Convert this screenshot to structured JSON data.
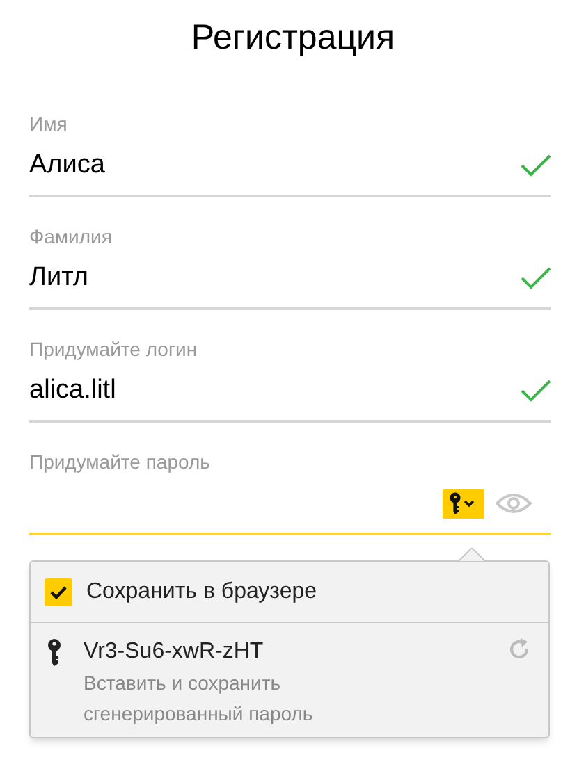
{
  "title": "Регистрация",
  "fields": [
    {
      "kind": "text",
      "label": "Имя",
      "value": "Алиса",
      "valid": true,
      "focused": false
    },
    {
      "kind": "text",
      "label": "Фамилия",
      "value": "Литл",
      "valid": true,
      "focused": false
    },
    {
      "kind": "text",
      "label": "Придумайте логин",
      "value": "alica.litl",
      "valid": true,
      "focused": false
    },
    {
      "kind": "password",
      "label": "Придумайте пароль",
      "valid": false,
      "focused": true
    }
  ],
  "popup": {
    "save_option": {
      "label": "Сохранить в браузере",
      "checked": true
    },
    "suggestion": {
      "password": "Vr3-Su6-xwR-zHT",
      "hint": "Вставить и сохранить сгенерированный пароль"
    }
  }
}
